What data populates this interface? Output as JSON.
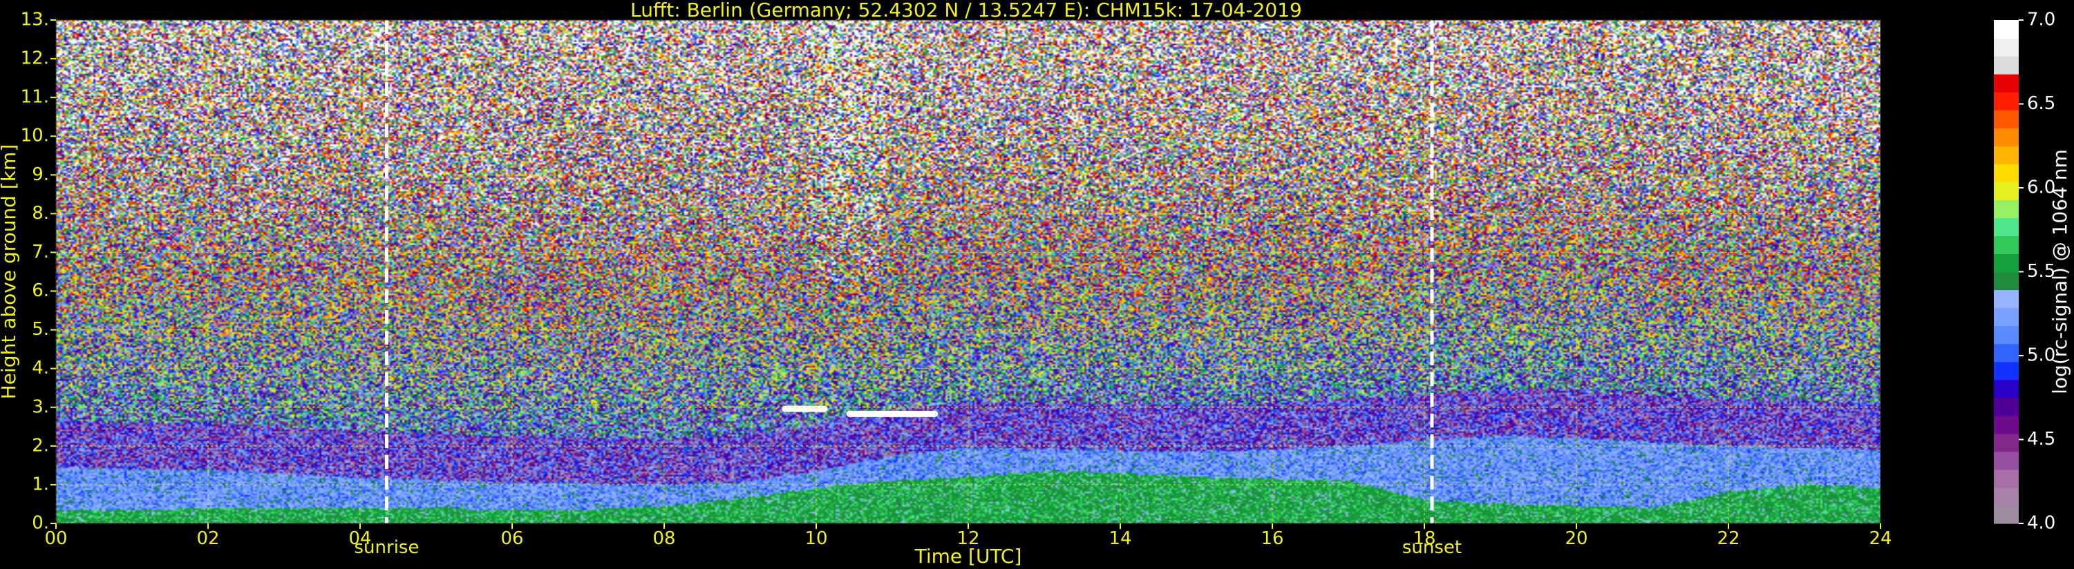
{
  "chart_data": {
    "type": "heatmap",
    "title": "Lufft: Berlin (Germany; 52.4302 N / 13.5247 E):    CHM15k: 17-04-2019",
    "xlabel": "Time [UTC]",
    "ylabel": "Height above ground [km]",
    "xlim": [
      0,
      24
    ],
    "ylim": [
      0,
      13
    ],
    "x_ticks": [
      0,
      2,
      4,
      6,
      8,
      10,
      12,
      14,
      16,
      18,
      20,
      22,
      24
    ],
    "x_tick_labels": [
      "00",
      "02",
      "04",
      "06",
      "08",
      "10",
      "12",
      "14",
      "16",
      "18",
      "20",
      "22",
      "24"
    ],
    "y_ticks": [
      0,
      1,
      2,
      3,
      4,
      5,
      6,
      7,
      8,
      9,
      10,
      11,
      12,
      13
    ],
    "y_tick_labels": [
      "0.",
      "1.",
      "2.",
      "3.",
      "4.",
      "5.",
      "6.",
      "7.",
      "8.",
      "9.",
      "10.",
      "11.",
      "12.",
      "13."
    ],
    "grid": true,
    "grid_color": "#e6e61a",
    "tick_color": "#f2f21a",
    "events": [
      {
        "name": "sunrise",
        "x": 4.35
      },
      {
        "name": "sunset",
        "x": 18.1
      }
    ],
    "cloud_layers": [
      {
        "x_start": 9.55,
        "x_end": 10.15,
        "height": 2.95
      },
      {
        "x_start": 10.4,
        "x_end": 11.6,
        "height": 2.82
      }
    ],
    "boundary_layer": {
      "x": [
        0,
        1,
        2,
        3,
        4,
        5,
        6,
        7,
        8,
        9,
        10,
        11,
        12,
        13,
        14,
        15,
        16,
        17,
        18,
        19,
        20,
        21,
        22,
        23,
        24
      ],
      "top_height": [
        1.45,
        1.4,
        1.38,
        1.28,
        1.18,
        1.1,
        1.05,
        1.02,
        0.98,
        1.05,
        1.35,
        1.75,
        1.95,
        1.92,
        1.88,
        1.85,
        1.9,
        2.0,
        2.15,
        2.25,
        2.2,
        2.1,
        2.0,
        1.95,
        1.9
      ],
      "mixed_height": [
        0.35,
        0.35,
        0.38,
        0.4,
        0.4,
        0.38,
        0.35,
        0.35,
        0.45,
        0.65,
        0.9,
        1.1,
        1.2,
        1.35,
        1.3,
        1.2,
        1.15,
        1.1,
        0.6,
        0.5,
        0.45,
        0.4,
        0.8,
        1.0,
        0.9
      ]
    },
    "colorbar": {
      "label": "log(rc-signal) @ 1064 nm",
      "range": [
        4.0,
        7.0
      ],
      "ticks": [
        4.0,
        4.5,
        5.0,
        5.5,
        6.0,
        6.5,
        7.0
      ],
      "tick_labels": [
        "4.0",
        "4.5",
        "5.0",
        "5.5",
        "6.0",
        "6.5",
        "7.0"
      ],
      "colors": [
        "#a08ca0",
        "#a882a8",
        "#a86ea8",
        "#9650a0",
        "#82288c",
        "#6e0a8c",
        "#500096",
        "#2800c8",
        "#1432ff",
        "#3264ff",
        "#5a8cff",
        "#78a0ff",
        "#96b4ff",
        "#1e8c3c",
        "#14a03c",
        "#32c85a",
        "#50e68c",
        "#96f064",
        "#e6f01e",
        "#ffdc00",
        "#ffb400",
        "#ff8c00",
        "#ff5a00",
        "#ff1e00",
        "#e60000",
        "#dcdcdc",
        "#f0f0f0",
        "#ffffff"
      ]
    }
  }
}
